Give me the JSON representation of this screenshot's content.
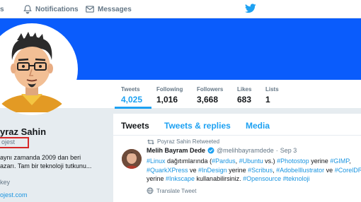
{
  "nav": {
    "notifications_label": "Notifications",
    "messages_label": "Messages"
  },
  "colors": {
    "brand_blue": "#1da1f2",
    "banner": "#0a5cfc",
    "link": "#1b95e0",
    "highlight_box": "#d62828"
  },
  "stats": [
    {
      "label": "Tweets",
      "value": "4,025"
    },
    {
      "label": "Following",
      "value": "1,016"
    },
    {
      "label": "Followers",
      "value": "3,668"
    },
    {
      "label": "Likes",
      "value": "683"
    },
    {
      "label": "Lists",
      "value": "1"
    }
  ],
  "profile": {
    "name": "yraz Sahin",
    "handle": "ojest",
    "bio_line1": "aynı zamanda 2009 dan beri",
    "bio_line2": "azarı. Tam bir teknoloji tutkunu...",
    "location": "key",
    "website": "ojest.com"
  },
  "tabs": {
    "tweets": "Tweets",
    "replies": "Tweets & replies",
    "media": "Media"
  },
  "tweet": {
    "retweet_label": "Poyraz Sahin Retweeted",
    "author_name": "Melih Bayram Dede",
    "author_handle": "@melihbayramdede",
    "separator": "·",
    "date": "Sep 3",
    "line1": [
      {
        "t": "#Linux",
        "h": true
      },
      {
        "t": " dağıtımlarında (",
        "h": false
      },
      {
        "t": "#Pardus",
        "h": true
      },
      {
        "t": ", ",
        "h": false
      },
      {
        "t": "#Ubuntu",
        "h": true
      },
      {
        "t": " vs.) ",
        "h": false
      },
      {
        "t": "#Photostop",
        "h": true
      },
      {
        "t": " yerine ",
        "h": false
      },
      {
        "t": "#GIMP",
        "h": true
      },
      {
        "t": ",",
        "h": false
      }
    ],
    "line2": [
      {
        "t": "#QuarkXPress",
        "h": true
      },
      {
        "t": " ve ",
        "h": false
      },
      {
        "t": "#InDesign",
        "h": true
      },
      {
        "t": " yerine ",
        "h": false
      },
      {
        "t": "#Scribus",
        "h": true
      },
      {
        "t": ", ",
        "h": false
      },
      {
        "t": "#AdobeIllustrator",
        "h": true
      },
      {
        "t": " ve ",
        "h": false
      },
      {
        "t": "#CorelDRAW",
        "h": true
      }
    ],
    "line3": [
      {
        "t": "yerine ",
        "h": false
      },
      {
        "t": "#Inkscape",
        "h": true
      },
      {
        "t": " kullanabilirsiniz. ",
        "h": false
      },
      {
        "t": "#Opensource",
        "h": true
      },
      {
        "t": " ",
        "h": false
      },
      {
        "t": "#teknoloji",
        "h": true
      }
    ],
    "translate_label": "Translate Tweet"
  }
}
